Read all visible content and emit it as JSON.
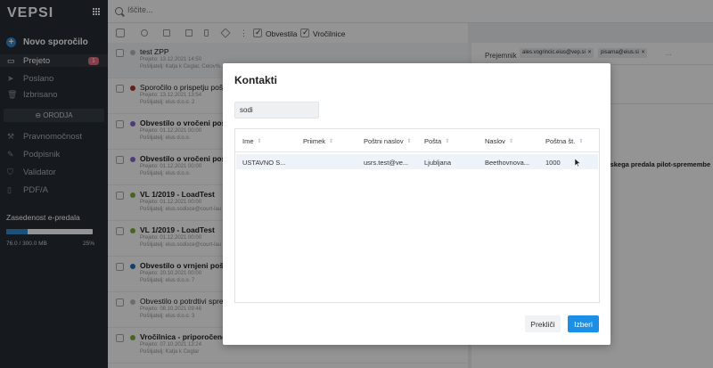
{
  "app": {
    "logo": "VEPSI",
    "new_message": "Novo sporočilo",
    "nav": [
      {
        "label": "Prejeto",
        "badge": "1",
        "icon": "inbox-icon",
        "active": true
      },
      {
        "label": "Poslano",
        "icon": "send-icon"
      },
      {
        "label": "Izbrisano",
        "icon": "trash-icon"
      }
    ],
    "tools_label": "ORODJA",
    "tools": [
      {
        "label": "Pravnomočnost",
        "icon": "gavel-icon"
      },
      {
        "label": "Podpisnik",
        "icon": "pen-icon"
      },
      {
        "label": "Validator",
        "icon": "shield-icon"
      },
      {
        "label": "PDF/A",
        "icon": "file-icon"
      }
    ],
    "storage": {
      "label": "Zasedenost e-predala",
      "used": "76.0 / 300.0 MB",
      "percent": "25%",
      "fraction": 0.25
    }
  },
  "search": {
    "placeholder": "Iščite..."
  },
  "toolbar": {
    "filter1": "Obvestila",
    "filter2": "Vročilnice"
  },
  "messages": [
    {
      "subject": "test ZPP",
      "meta1": "Prejeto: 13.12.2021 14:50",
      "meta2": "Pošiljatelj: Katja k Ceglar, Celov%...",
      "dot": "#b7bcc1",
      "bold": false
    },
    {
      "subject": "Sporočilo o prispetju pošiljk",
      "meta1": "Prejeto: 13.12.2021 13:54",
      "meta2": "Pošiljatelj: elus d.o.o. 2",
      "dot": "#a93232",
      "bold": false
    },
    {
      "subject": "Obvestilo o vročeni pošiljki",
      "meta1": "Prejeto: 01.12.2021 00:00",
      "meta2": "Pošiljatelj: elus d.o.o.",
      "dot": "#8a67d1",
      "bold": true
    },
    {
      "subject": "Obvestilo o vročeni pošiljki",
      "meta1": "Prejeto: 01.12.2021 00:00",
      "meta2": "Pošiljatelj: elus d.o.o.",
      "dot": "#8a67d1",
      "bold": true
    },
    {
      "subject": "VL 1/2019 - LoadTest",
      "meta1": "Prejeto: 01.12.2021 00:00",
      "meta2": "Pošiljatelj: elus.sodisce@court-lau",
      "dot": "#7cac3a",
      "bold": true
    },
    {
      "subject": "VL 1/2019 - LoadTest",
      "meta1": "Prejeto: 01.12.2021 00:00",
      "meta2": "Pošiljatelj: elus.sodisce@court-lau",
      "dot": "#7cac3a",
      "bold": true
    },
    {
      "subject": "Obvestilo o vrnjeni pošiljki",
      "meta1": "Prejeto: 20.10.2021 00:00",
      "meta2": "Pošiljatelj: elus d.o.o. 7",
      "dot": "#1d6fb8",
      "bold": true
    },
    {
      "subject": "Obvestilo o potrdtivi sprejem",
      "meta1": "Prejeto: 08.10.2021 09:46",
      "meta2": "Pošiljatelj: elus d.o.o. 3",
      "dot": "#b7bcc1",
      "bold": false
    },
    {
      "subject": "Vročilnica - priporočeno Re: test Zars (ARES)",
      "meta1": "Prejeto: 07.10.2021 13:24",
      "meta2": "Pošiljatelj: Katja k Ceglar",
      "dot": "#7cac3a",
      "bold": true
    }
  ],
  "detail": {
    "recipient_label": "Prejemnik",
    "recipients": [
      "ales.vogrincic.eius@vep.si",
      "pisarna@eius.si"
    ],
    "ellipsis": "...",
    "text": "nskega predala pilot-spremembe"
  },
  "modal": {
    "title": "Kontakti",
    "filter_value": "sodi",
    "columns": [
      "Ime",
      "Priimek",
      "Poštni naslov",
      "Pošta",
      "Naslov",
      "Poštna št."
    ],
    "rows": [
      {
        "ime": "USTAVNO S...",
        "priimek": "",
        "postni_naslov": "usrs.test@ve...",
        "posta": "Ljubljana",
        "naslov": "Beethovnova...",
        "postna_st": "1000"
      }
    ],
    "cancel_label": "Prekliči",
    "select_label": "Izberi"
  }
}
